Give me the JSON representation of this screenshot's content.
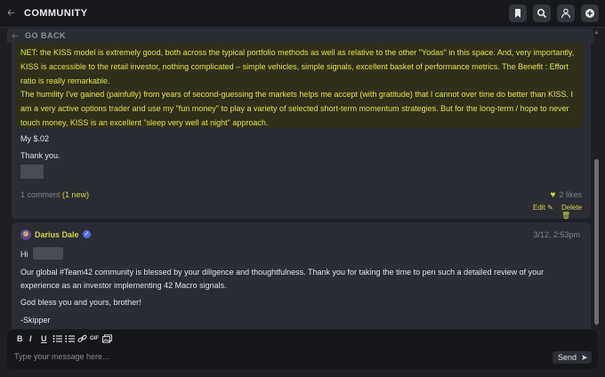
{
  "app": {
    "title": "COMMUNITY"
  },
  "nav": {
    "go_back": "GO BACK"
  },
  "comment1": {
    "para1": "NET: the KISS model is extremely good, both across the typical portfolio methods as well as relative to the other \"Yodas\" in this space. And, very importantly, KISS is accessible to the retail investor, nothing complicated – simple vehicles, simple signals, excellent basket of performance metrics. The Benefit : Effort ratio is really remarkable.",
    "para2": "The humility I've gained (painfully) from years of second-guessing the markets helps me accept (with gratitude) that I cannot over time do better than KISS. I am a very active options trader and use my \"fun money\" to play a variety of selected short-term momentum strategies. But for the long-term / hope to never touch money, KISS is an excellent \"sleep very well at night\" approach.",
    "line_my": "My $.02",
    "line_thanks": "Thank you.",
    "comment_count": "1 comment",
    "comment_new": "(1 new)",
    "likes": "2 likes",
    "edit": "Edit",
    "delete": "Delete"
  },
  "reply": {
    "author": "Darius Dale",
    "date": "3/12, 2:53pm",
    "greeting": "Hi",
    "para1": "Our global #Team42 community is blessed by your diligence and thoughtfulness. Thank you for taking the time to pen such a detailed review of your experience as an investor implementing 42 Macro signals.",
    "para2": "God bless you and yours, brother!",
    "signoff": "-Skipper"
  },
  "composer": {
    "placeholder": "Type your message here...",
    "send": "Send",
    "tools": {
      "bold": "B",
      "italic": "I",
      "underline": "U",
      "gif": "GIF"
    }
  },
  "colors": {
    "accent": "#d8d24a",
    "background": "#1e1f25",
    "card": "#2b2d34",
    "highlight": "#2f2f1c"
  }
}
